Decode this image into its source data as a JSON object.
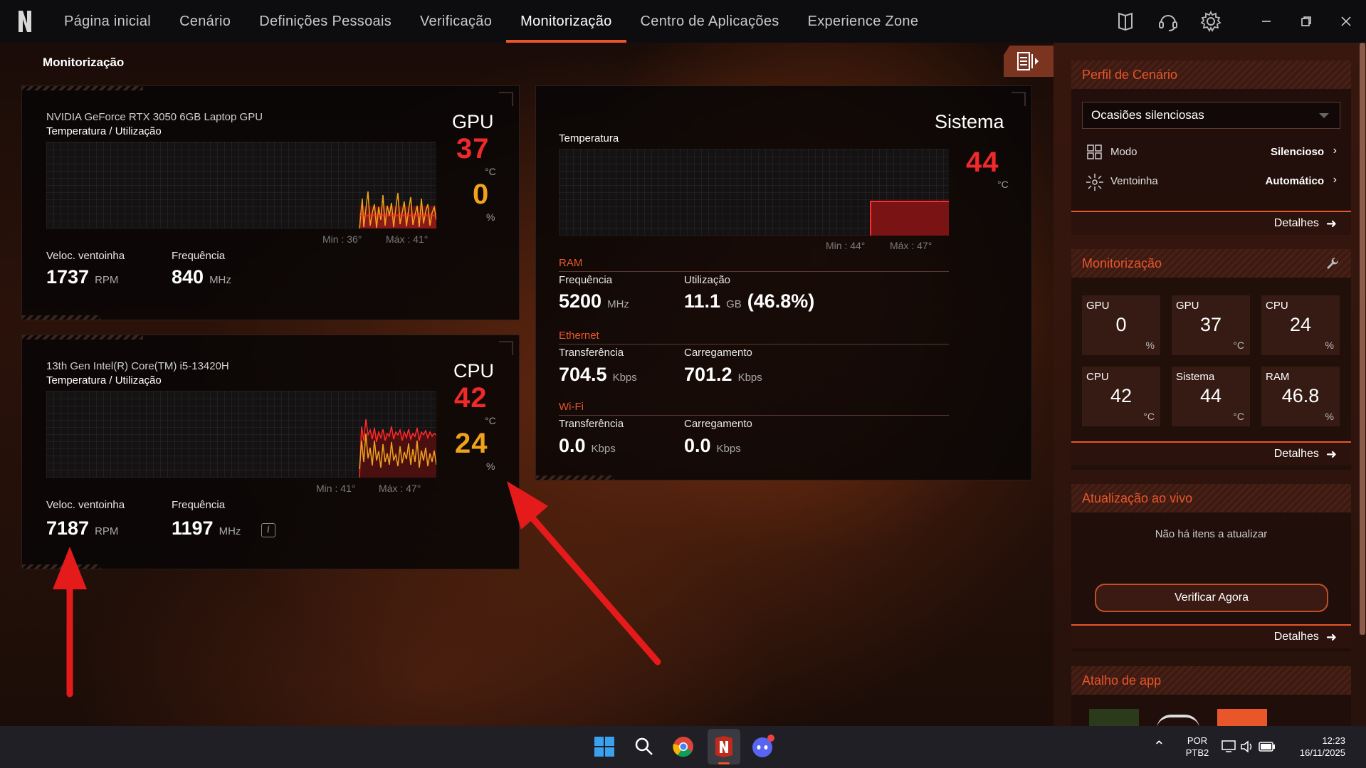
{
  "nav": {
    "items": [
      "Página inicial",
      "Cenário",
      "Definições Pessoais",
      "Verificação",
      "Monitorização",
      "Centro de Aplicações",
      "Experience Zone"
    ],
    "active_index": 4
  },
  "page": {
    "title": "Monitorização"
  },
  "gpu_panel": {
    "device": "NVIDIA GeForce RTX 3050 6GB Laptop GPU",
    "subtitle": "Temperatura / Utilização",
    "label": "GPU",
    "temp": "37",
    "temp_unit": "°C",
    "usage": "0",
    "usage_unit": "%",
    "min": "Min : 36°",
    "max": "Máx : 41°",
    "fan_label": "Veloc. ventoinha",
    "fan_value": "1737",
    "fan_unit": "RPM",
    "freq_label": "Frequência",
    "freq_value": "840",
    "freq_unit": "MHz"
  },
  "cpu_panel": {
    "device": "13th Gen Intel(R) Core(TM) i5-13420H",
    "subtitle": "Temperatura / Utilização",
    "label": "CPU",
    "temp": "42",
    "temp_unit": "°C",
    "usage": "24",
    "usage_unit": "%",
    "min": "Min : 41°",
    "max": "Máx : 47°",
    "fan_label": "Veloc. ventoinha",
    "fan_value": "7187",
    "fan_unit": "RPM",
    "freq_label": "Frequência",
    "freq_value": "1197",
    "freq_unit": "MHz"
  },
  "system_panel": {
    "label": "Sistema",
    "temp_label": "Temperatura",
    "temp": "44",
    "temp_unit": "°C",
    "min": "Min : 44°",
    "max": "Máx : 47°",
    "ram": {
      "head": "RAM",
      "freq_label": "Frequência",
      "freq_value": "5200",
      "freq_unit": "MHz",
      "use_label": "Utilização",
      "use_value": "11.1",
      "use_unit": "GB",
      "use_pct": "(46.8%)"
    },
    "ethernet": {
      "head": "Ethernet",
      "tx_label": "Transferência",
      "tx_value": "704.5",
      "tx_unit": "Kbps",
      "rx_label": "Carregamento",
      "rx_value": "701.2",
      "rx_unit": "Kbps"
    },
    "wifi": {
      "head": "Wi-Fi",
      "tx_label": "Transferência",
      "tx_value": "0.0",
      "tx_unit": "Kbps",
      "rx_label": "Carregamento",
      "rx_value": "0.0",
      "rx_unit": "Kbps"
    }
  },
  "sidebar": {
    "profile": {
      "title": "Perfil de Cenário",
      "selected": "Ocasiões silenciosas",
      "mode_label": "Modo",
      "mode_value": "Silencioso",
      "fan_label": "Ventoinha",
      "fan_value": "Automático",
      "details": "Detalhes"
    },
    "monitor": {
      "title": "Monitorização",
      "tiles": [
        {
          "name": "GPU",
          "value": "0",
          "unit": "%"
        },
        {
          "name": "GPU",
          "value": "37",
          "unit": "°C"
        },
        {
          "name": "CPU",
          "value": "24",
          "unit": "%"
        },
        {
          "name": "CPU",
          "value": "42",
          "unit": "°C"
        },
        {
          "name": "Sistema",
          "value": "44",
          "unit": "°C"
        },
        {
          "name": "RAM",
          "value": "46.8",
          "unit": "%"
        }
      ],
      "details": "Detalhes"
    },
    "live_update": {
      "title": "Atualização ao vivo",
      "empty": "Não há itens a atualizar",
      "button": "Verificar Agora",
      "details": "Detalhes"
    },
    "shortcut": {
      "title": "Atalho de app"
    }
  },
  "taskbar": {
    "lang_top": "POR",
    "lang_bottom": "PTB2",
    "time": "12:23",
    "date": "16/11/2025"
  },
  "colors": {
    "accent": "#e8562a",
    "temp_red": "#ee2a2a",
    "usage_orange": "#f0a21c"
  }
}
